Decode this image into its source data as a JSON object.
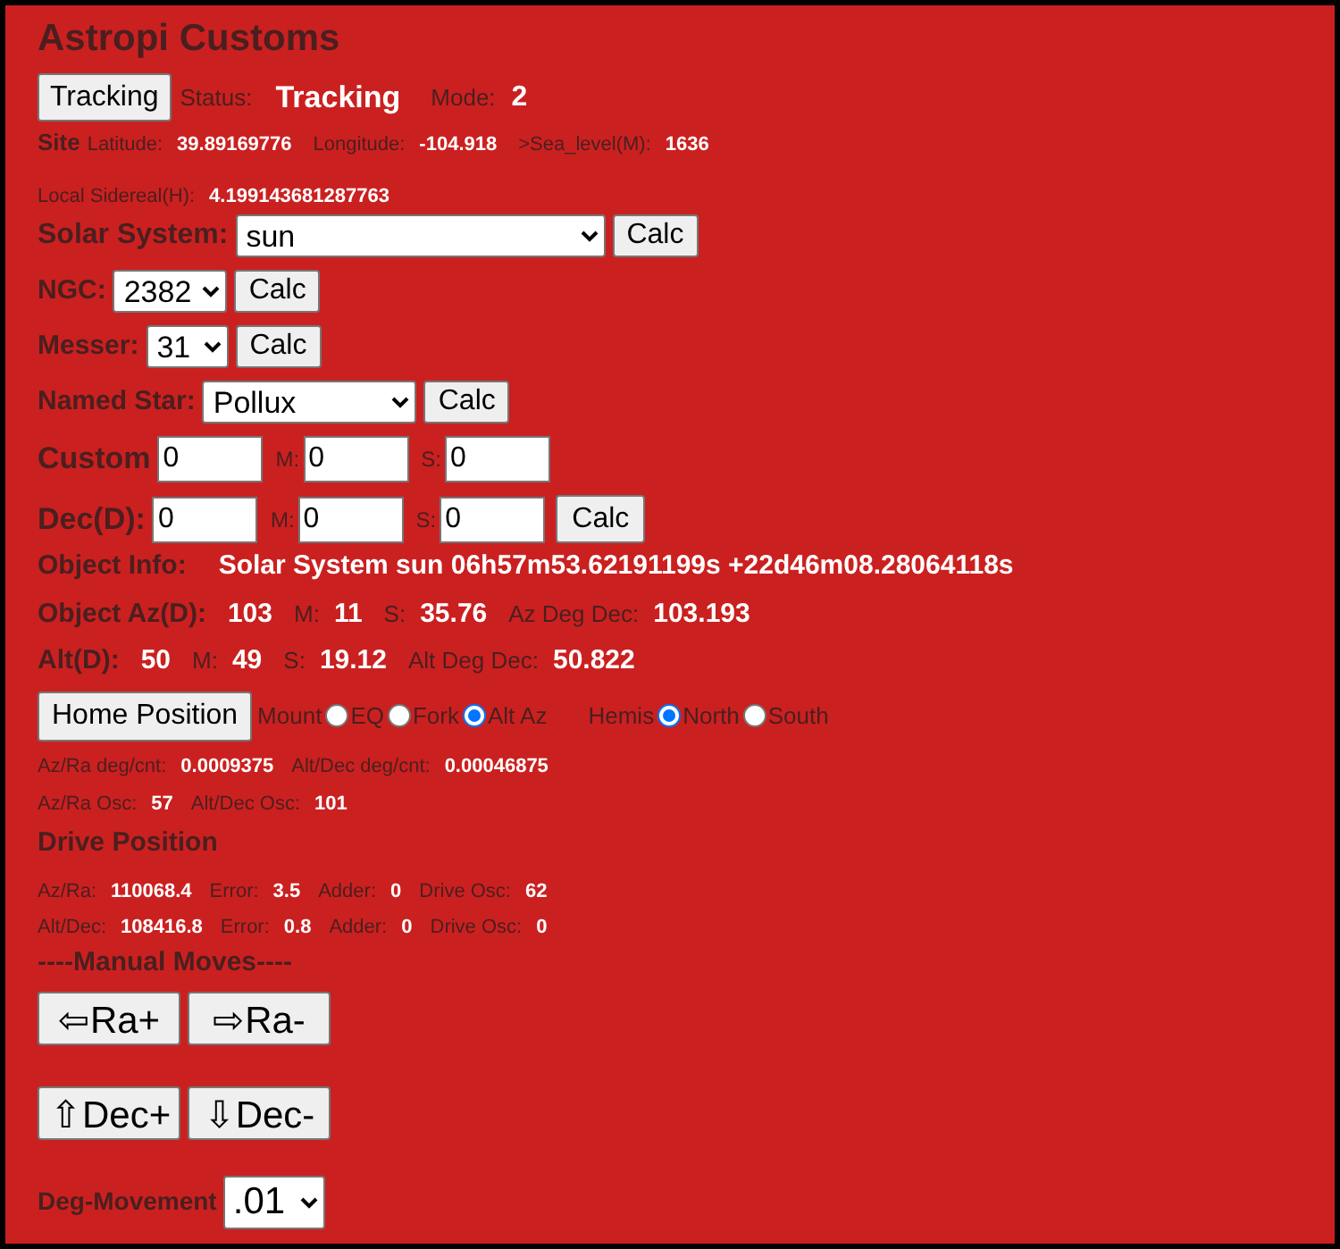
{
  "title": "Astropi Customs",
  "status": {
    "button": "Tracking",
    "status_label": "Status:",
    "status_value": "Tracking",
    "mode_label": "Mode:",
    "mode_value": "2"
  },
  "site": {
    "heading": "Site",
    "fields": [
      {
        "label": "Latitude:",
        "value": "39.89169776"
      },
      {
        "label": "Longitude:",
        "value": "-104.918"
      },
      {
        "label": ">Sea_level(M):",
        "value": "1636"
      }
    ]
  },
  "sidereal": {
    "label": "Local Sidereal(H):",
    "value": "4.199143681287763"
  },
  "selectors": [
    {
      "label": "Solar System:",
      "value": "sun",
      "button": "Calc"
    },
    {
      "label": "NGC:",
      "value": "2382",
      "button": "Calc"
    },
    {
      "label": "Messer:",
      "value": "31",
      "button": "Calc"
    },
    {
      "label": "Named Star:",
      "value": "Pollux",
      "button": "Calc"
    }
  ],
  "custom_rows": [
    {
      "label": "Custom",
      "fields": [
        {
          "value": "0"
        },
        {
          "label": "M:",
          "value": "0"
        },
        {
          "label": "S:",
          "value": "0"
        }
      ]
    },
    {
      "label": "Dec(D):",
      "fields": [
        {
          "value": "0"
        },
        {
          "label": "M:",
          "value": "0"
        },
        {
          "label": "S:",
          "value": "0"
        }
      ],
      "button": "Calc"
    }
  ],
  "object_info": {
    "label": "Object Info:",
    "value": "Solar System sun 06h57m53.62191199s +22d46m08.28064118s"
  },
  "position_rows": [
    {
      "label": "Object Az(D):",
      "fields": [
        {
          "value": "103"
        },
        {
          "label": "M:",
          "value": "11"
        },
        {
          "label": "S:",
          "value": "35.76"
        },
        {
          "label": "Az Deg Dec:",
          "value": "103.193"
        }
      ]
    },
    {
      "label": "Alt(D):",
      "fields": [
        {
          "value": "50"
        },
        {
          "label": "M:",
          "value": "49"
        },
        {
          "label": "S:",
          "value": "19.12"
        },
        {
          "label": "Alt Deg Dec:",
          "value": "50.822"
        }
      ]
    }
  ],
  "home": {
    "button": "Home Position",
    "groups": [
      {
        "label": "Mount",
        "options": [
          {
            "label": "EQ",
            "selected": false
          },
          {
            "label": "Fork",
            "selected": false
          },
          {
            "label": "Alt Az",
            "selected": true
          }
        ]
      },
      {
        "label": "Hemis",
        "options": [
          {
            "label": "North",
            "selected": true
          },
          {
            "label": "South",
            "selected": false
          }
        ]
      }
    ]
  },
  "rates": [
    [
      {
        "label": "Az/Ra deg/cnt:",
        "value": "0.0009375"
      },
      {
        "label": "Alt/Dec deg/cnt:",
        "value": "0.00046875"
      }
    ],
    [
      {
        "label": "Az/Ra Osc:",
        "value": "57"
      },
      {
        "label": "Alt/Dec Osc:",
        "value": "101"
      }
    ]
  ],
  "drive": {
    "heading": "Drive Position",
    "rows": [
      [
        {
          "label": "Az/Ra:",
          "value": "110068.4"
        },
        {
          "label": "Error:",
          "value": "3.5"
        },
        {
          "label": "Adder:",
          "value": "0"
        },
        {
          "label": "Drive Osc:",
          "value": "62"
        }
      ],
      [
        {
          "label": "Alt/Dec:",
          "value": "108416.8"
        },
        {
          "label": "Error:",
          "value": "0.8"
        },
        {
          "label": "Adder:",
          "value": "0"
        },
        {
          "label": "Drive Osc:",
          "value": "0"
        }
      ]
    ]
  },
  "manual": {
    "heading": "----Manual Moves----",
    "button_rows": [
      [
        "⇦Ra+",
        "⇨Ra-"
      ],
      [
        "⇧Dec+",
        "⇩Dec-"
      ]
    ]
  },
  "deg_movement": {
    "label": "Deg-Movement",
    "value": ".01"
  }
}
